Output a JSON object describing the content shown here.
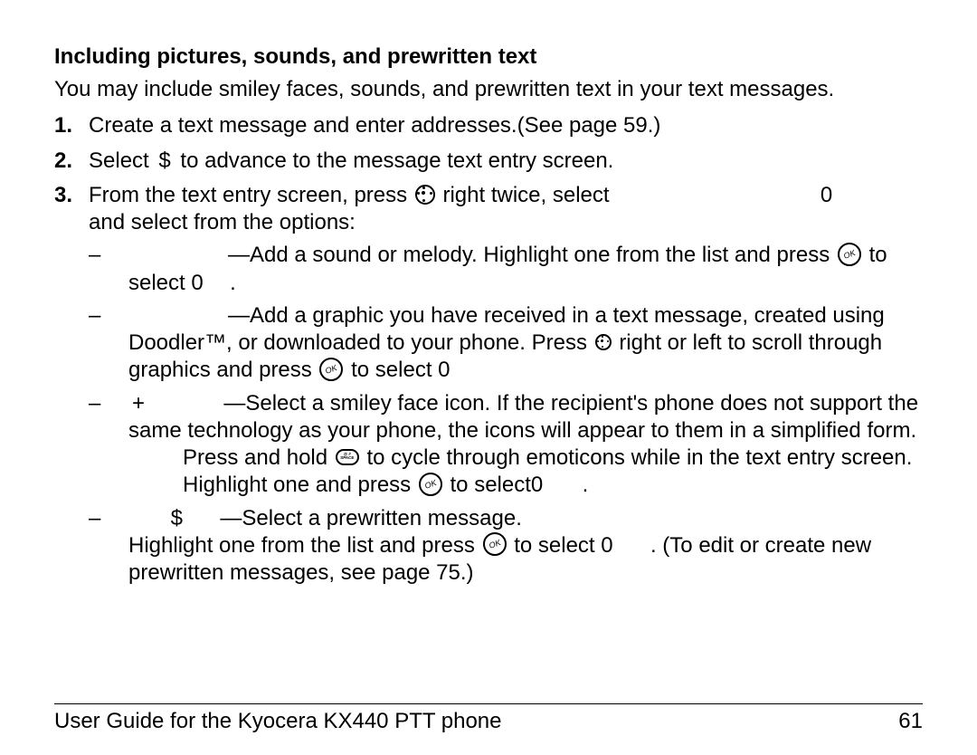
{
  "heading": "Including pictures, sounds, and prewritten text",
  "intro": "You may include smiley faces, sounds, and prewritten text in your text messages.",
  "steps": {
    "n1": "1.",
    "s1": "Create a text message and enter addresses.(See page 59.)",
    "n2": "2.",
    "s2a": "Select",
    "s2sym": "$",
    "s2b": "to advance to the message text entry screen.",
    "n3": "3.",
    "s3a": "From the text entry screen, press",
    "s3b": "right twice, select",
    "s3zero": "0",
    "s3c": "and select from the options:"
  },
  "subs": {
    "dash": "–",
    "bullet1a": "—Add a sound or melody. Highlight one from the list and press",
    "bullet1b": "to select 0",
    "dot1": ".",
    "bullet2a": "—Add a graphic you have received in a text message, created using Doodler™, or downloaded to your phone. Press",
    "bullet2b": "right or left to scroll through graphics and press",
    "bullet2c": "to select 0",
    "bullet3prefix": "+",
    "bullet3a": "—Select a smiley face icon. If the recipient's phone does not support the same technology as your phone, the icons will appear to them in a simplified form.",
    "tip3a": "Press and hold",
    "tip3b": "to cycle through emoticons while in the text entry screen. Highlight one and press",
    "tip3c": "to select",
    "tip3zero": "0",
    "tip3dot": ".",
    "bullet4sym": "$",
    "bullet4a": "—Select a prewritten message.",
    "bullet4b": "Highlight one from the list and press",
    "bullet4c": "to select 0",
    "bullet4d": ". (To edit or create new prewritten messages, see page 75.)"
  },
  "footer": {
    "left": "User Guide for the Kyocera KX440 PTT phone",
    "right": "61"
  },
  "icon_space_label": "@ #\nSPACE"
}
